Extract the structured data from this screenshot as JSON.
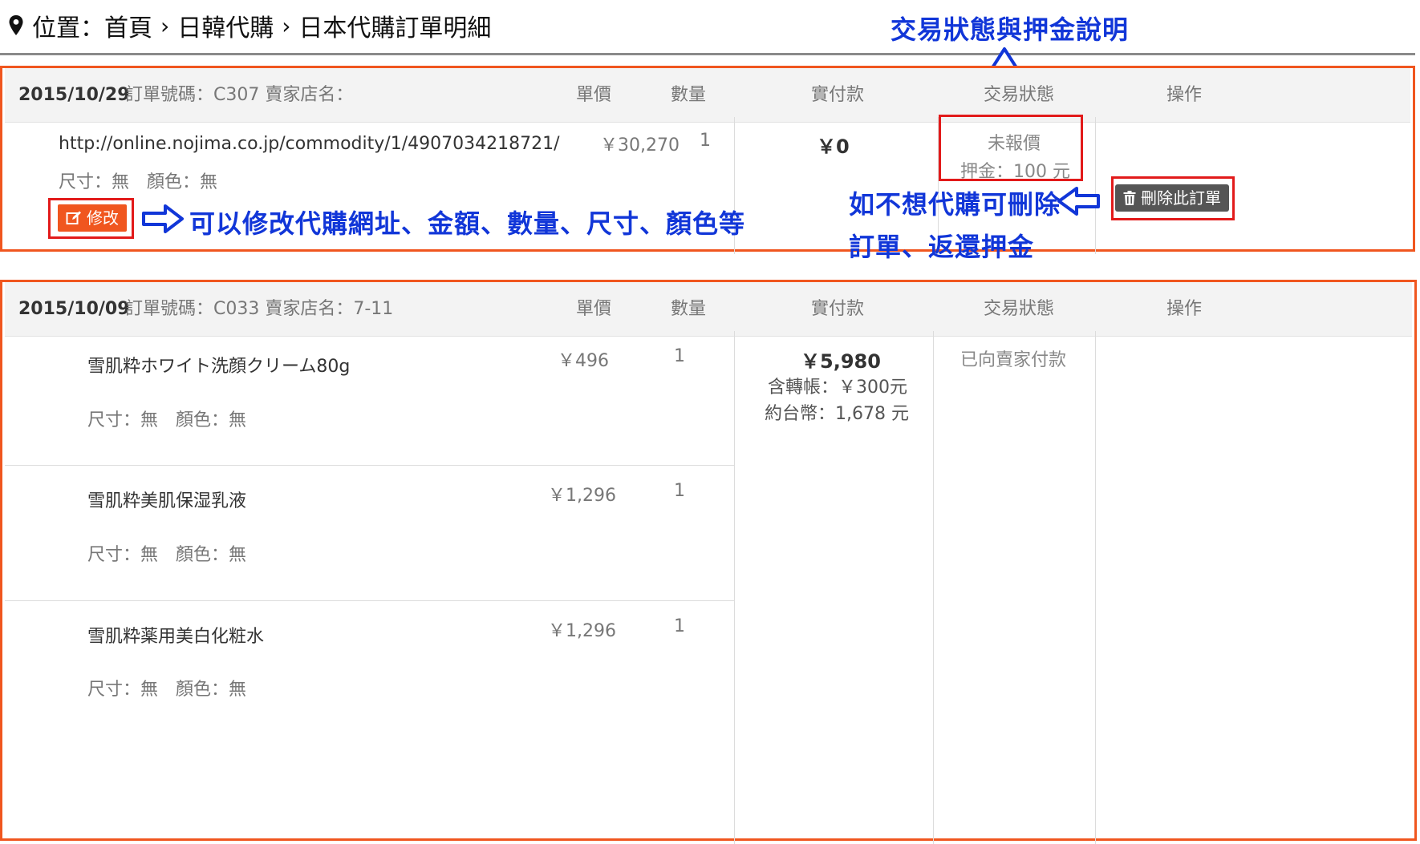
{
  "breadcrumb": {
    "label": "位置：首頁",
    "level1": "日韓代購",
    "level2": "日本代購訂單明細",
    "sep": "›"
  },
  "annotations": {
    "status_help": "交易狀態與押金說明",
    "edit_help": "可以修改代購網址、金額、數量、尺寸、顏色等",
    "delete_help_line1": "如不想代購可刪除",
    "delete_help_line2": "訂單、返還押金"
  },
  "headers": {
    "price": "單價",
    "qty": "數量",
    "paid": "實付款",
    "status": "交易狀態",
    "action": "操作"
  },
  "orders": [
    {
      "date": "2015/10/29",
      "order_info": "訂單號碼：C307 賣家店名：",
      "items": [
        {
          "name": "http://online.nojima.co.jp/commodity/1/4907034218721/",
          "spec": "尺寸：無　顏色：無",
          "price": "￥30,270",
          "qty": "1"
        }
      ],
      "paid": "￥0",
      "status_line1": "未報價",
      "status_line2": "押金：100 元",
      "edit_label": "修改",
      "delete_label": "刪除此訂單"
    },
    {
      "date": "2015/10/09",
      "order_info": "訂單號碼：C033 賣家店名：7-11",
      "items": [
        {
          "name": "雪肌粋ホワイト洗顔クリーム80g",
          "spec": "尺寸：無　顏色：無",
          "price": "￥496",
          "qty": "1"
        },
        {
          "name": "雪肌粋美肌保湿乳液",
          "spec": "尺寸：無　顏色：無",
          "price": "￥1,296",
          "qty": "1"
        },
        {
          "name": "雪肌粋薬用美白化粧水",
          "spec": "尺寸：無　顏色：無",
          "price": "￥1,296",
          "qty": "1"
        }
      ],
      "paid": "￥5,980",
      "paid_transfer": "含轉帳：￥300元",
      "paid_twd": "約台幣：1,678 元",
      "status_line1": "已向賣家付款"
    }
  ],
  "colors": {
    "accent": "#f0561f",
    "annotation": "#1136d8",
    "highlight_box": "#e21a1a"
  }
}
